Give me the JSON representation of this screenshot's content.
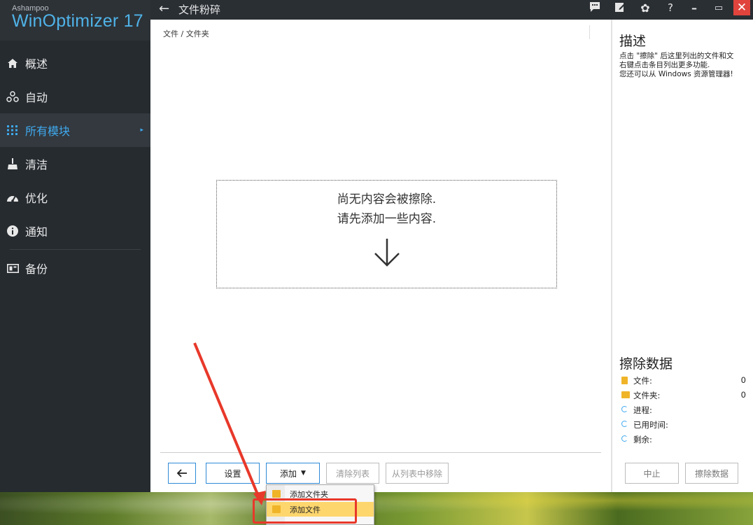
{
  "app": {
    "brand_small": "Ashampoo",
    "brand_name": "WinOptimizer",
    "brand_version": "17",
    "window_title": "文件粉碎"
  },
  "sidebar": {
    "items": [
      {
        "label": "概述",
        "icon": "home-icon"
      },
      {
        "label": "自动",
        "icon": "auto-icon"
      },
      {
        "label": "所有模块",
        "icon": "grid-icon",
        "active": true
      },
      {
        "label": "清洁",
        "icon": "broom-icon"
      },
      {
        "label": "优化",
        "icon": "speedometer-icon"
      },
      {
        "label": "通知",
        "icon": "info-icon"
      },
      {
        "label": "备份",
        "icon": "backup-icon"
      }
    ]
  },
  "main": {
    "breadcrumb": "文件 / 文件夹",
    "empty_line1": "尚无内容会被擦除.",
    "empty_line2": "请先添加一些内容."
  },
  "right_panel": {
    "desc_title": "描述",
    "desc_lines": [
      "点击 \"擦除\" 后这里列出的文件和文",
      "右键点击条目列出更多功能.",
      "您还可以从 Windows 资源管理器!"
    ],
    "erase_title": "擦除数据",
    "stats": [
      {
        "label": "文件:",
        "value": "0",
        "icon": "file-icon"
      },
      {
        "label": "文件夹:",
        "value": "0",
        "icon": "folder-icon"
      },
      {
        "label": "进程:",
        "value": "",
        "icon": "progress-icon"
      },
      {
        "label": "已用时间:",
        "value": "",
        "icon": "elapsed-icon"
      },
      {
        "label": "剩余:",
        "value": "",
        "icon": "remaining-icon"
      }
    ]
  },
  "buttons": {
    "back": "←",
    "settings": "设置",
    "add": "添加",
    "clear_list": "清除列表",
    "remove_from_list": "从列表中移除",
    "stop": "中止",
    "erase_data": "擦除数据"
  },
  "add_menu": {
    "items": [
      {
        "label": "添加文件夹",
        "highlighted": false
      },
      {
        "label": "添加文件",
        "highlighted": true
      }
    ]
  },
  "colors": {
    "accent": "#3fa9ef",
    "sidebar_bg": "#262b30",
    "close_red": "#e0443d",
    "annotation_red": "#e8382a",
    "menu_highlight": "#fdd66e"
  }
}
